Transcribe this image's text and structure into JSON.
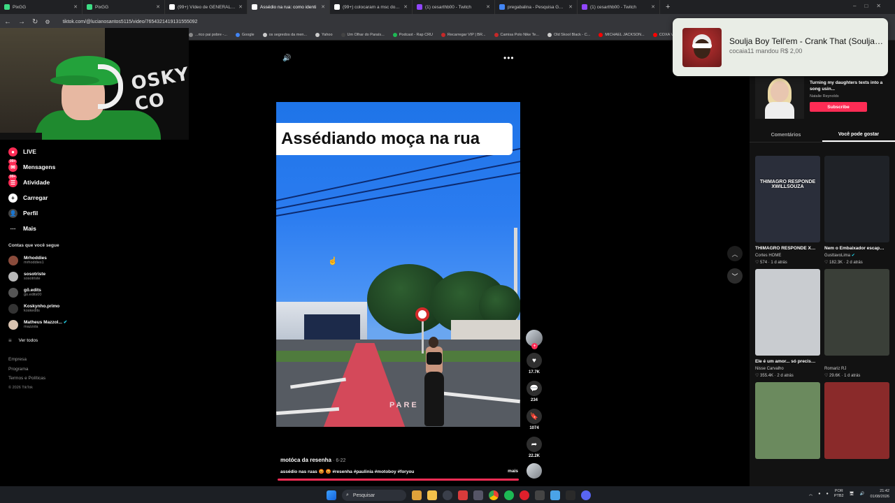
{
  "browser": {
    "tabs": [
      {
        "title": "PixGG",
        "icon": "pixgg-icon",
        "color": "#3ddc84",
        "active": false
      },
      {
        "title": "PixGG",
        "icon": "pixgg-icon",
        "color": "#3ddc84",
        "active": false
      },
      {
        "title": "(99+) Vídeo de GENERAL - ROI",
        "icon": "tiktok-icon",
        "color": "#ffffff",
        "active": false
      },
      {
        "title": "Assédio na rua: como identi",
        "icon": "tiktok-icon",
        "color": "#ffffff",
        "active": true
      },
      {
        "title": "(99+) colocaram a msc do kosk",
        "icon": "tiktok-icon",
        "color": "#ffffff",
        "active": false
      },
      {
        "title": "(1) cesarthb00 - Twitch",
        "icon": "twitch-icon",
        "color": "#9146ff",
        "active": false
      },
      {
        "title": "pregabalina - Pesquisa Google",
        "icon": "google-icon",
        "color": "#4285f4",
        "active": false
      },
      {
        "title": "(1) cesarthb00 - Twitch",
        "icon": "twitch-icon",
        "color": "#9146ff",
        "active": false
      }
    ],
    "url": "tiktok.com/@lucianosantos5115/video/7654321419131555092",
    "bookmarks": [
      {
        "label": "...rico pai pobre -...",
        "color": "#888888"
      },
      {
        "label": "Google",
        "color": "#4285f4"
      },
      {
        "label": "os segredos da men...",
        "color": "#cccccc"
      },
      {
        "label": "Yahoo",
        "color": "#cccccc"
      },
      {
        "label": "Um Olhar do Paraís...",
        "color": "#444444"
      },
      {
        "label": "Podcast - Rap CRU",
        "color": "#1db954"
      },
      {
        "label": "Recarregar VIP | BR...",
        "color": "#c62828"
      },
      {
        "label": "Camisa Polo Nike Te...",
        "color": "#c62828"
      },
      {
        "label": "Old Skool Black - C...",
        "color": "#cccccc"
      },
      {
        "label": "MICHAEL JACKSON...",
        "color": "#ff0000"
      },
      {
        "label": "COXA V",
        "color": "#ff0000"
      }
    ]
  },
  "nav": {
    "items": [
      {
        "label": "LIVE",
        "icon": "live-icon",
        "badge": ""
      },
      {
        "label": "Mensagens",
        "icon": "messages-icon",
        "badge": "99+"
      },
      {
        "label": "Atividade",
        "icon": "activity-icon",
        "badge": "99+"
      },
      {
        "label": "Carregar",
        "icon": "upload-icon",
        "badge": ""
      },
      {
        "label": "Perfil",
        "icon": "profile-icon",
        "badge": ""
      },
      {
        "label": "Mais",
        "icon": "more-icon",
        "badge": ""
      }
    ],
    "following_header": "Contas que você segue",
    "following": [
      {
        "name": "Mrhoddies",
        "user": "mrhoddies1",
        "color": "#8a4b3b",
        "verified": false
      },
      {
        "name": "sosotriste",
        "user": "sosotriste",
        "color": "#b8b8b8",
        "verified": false
      },
      {
        "name": "gõ.edits",
        "user": "go.edits00",
        "color": "#555555",
        "verified": false
      },
      {
        "name": "Koskynho.primo",
        "user": "koskedits",
        "color": "#333333",
        "verified": false
      },
      {
        "name": "Matheus Mazzol...",
        "user": "mazzola",
        "color": "#d9c3b0",
        "verified": true
      }
    ],
    "see_all": "Ver todos",
    "footer": [
      "Empresa",
      "Programa",
      "Termos e Políticas"
    ],
    "copyright": "© 2026 TikTok"
  },
  "video": {
    "title_overlay": "Assédiando moça na rua",
    "road_text": "PARE",
    "author": "motóca da resenha",
    "date": "· 6-22",
    "caption": "assédio  nas ruas 😡 😡 #resenha #paulinia #motoboy #foryou",
    "more": "mais",
    "progress": 1.0
  },
  "actions": {
    "likes": "17.7K",
    "comments": "234",
    "saves": "1074",
    "shares": "22.2K"
  },
  "right": {
    "ad_title": "Turning my daughters texts into a song usin...",
    "ad_author": "Natalie Reynolds",
    "ad_button": "Subscribe",
    "tabs": [
      "Comentários",
      "Você pode gostar"
    ],
    "active_tab": 1,
    "cards": [
      {
        "title": "THIMAGRO RESPONDE XWILLSOUZA #cortes...",
        "author": "Cortes HOME",
        "likes": "574",
        "age": "1 d atrás",
        "bg": "#2a2e3a",
        "verified": false,
        "overlay": "THIMAGRO RESPONDE XWILLSOUZA"
      },
      {
        "title": "Nem o Embaixador escapa, bb. Parabéns...",
        "author": "GusttavoLima",
        "likes": "182.3K",
        "age": "2 d atrás",
        "bg": "#1f2227",
        "verified": true,
        "overlay": ""
      },
      {
        "title": "Ele é um amor... só precisa de um pouco ...",
        "author": "Nisse Carvalho",
        "likes": "355.4K",
        "age": "2 d atrás",
        "bg": "#c9ccd0",
        "verified": false,
        "overlay": ""
      },
      {
        "title": "",
        "author": "Romariz RJ",
        "likes": "29.6K",
        "age": "1 d atrás",
        "bg": "#3a3f38",
        "verified": false,
        "overlay": ""
      },
      {
        "title": "",
        "author": "",
        "likes": "",
        "age": "",
        "bg": "#6b8a5e",
        "verified": false,
        "overlay": ""
      },
      {
        "title": "",
        "author": "",
        "likes": "",
        "age": "",
        "bg": "#8a2a2a",
        "verified": false,
        "overlay": ""
      }
    ]
  },
  "notification": {
    "title": "Soulja Boy Tell'em - Crank That (Soulja Boy)",
    "subtitle": "cocaia11 mandou R$ 2,00"
  },
  "taskbar": {
    "search": "Pesquisar",
    "lang": "POR",
    "lang2": "PTB2",
    "time": "21:42",
    "date": "01/08/2026"
  }
}
